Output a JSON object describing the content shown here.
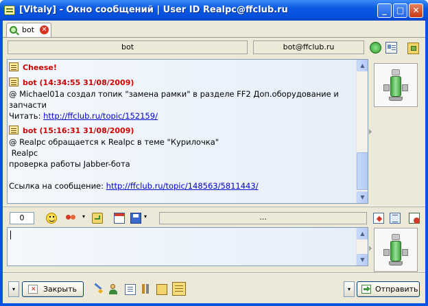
{
  "window": {
    "title": "[Vitaly] - Окно сообщений | User ID Realpc@ffclub.ru",
    "minimize_glyph": "_",
    "maximize_glyph": "□",
    "close_glyph": "✕"
  },
  "tabs": [
    {
      "label": "bot",
      "close_glyph": "✕"
    }
  ],
  "contact": {
    "name": "bot",
    "jid": "bot@ffclub.ru"
  },
  "messages": {
    "first_header": "Cheese!",
    "m1_header": "bot (14:34:55 31/08/2009)",
    "m1_line1": "@ Michael01a создал топик \"замена рамки\" в разделе FF2 Доп.оборудование и",
    "m1_line2": "запчасти",
    "m1_read_label": "Читать: ",
    "m1_link": "http://ffclub.ru/topic/152159/",
    "m2_header": "bot (15:16:31 31/08/2009)",
    "m2_line1": "@ Realpc обращается к Realpc в теме \"Курилочка\"",
    "m2_line2": " Realpc",
    "m2_line3": "проверка работы Jabber-бота",
    "m2_link_label": "Ссылка на сообщение: ",
    "m2_link": "http://ffclub.ru/topic/148563/5811443/"
  },
  "toolbar": {
    "char_count": "0",
    "status_text": "...",
    "dropdown_glyph": "▾"
  },
  "input": {
    "value": ""
  },
  "bottom": {
    "close_label": "Закрыть",
    "send_label": "Отправить",
    "dropdown_glyph": "▾"
  },
  "scroll": {
    "up_glyph": "▲",
    "down_glyph": "▼"
  },
  "colors": {
    "header_red": "#cc0000",
    "link_blue": "#0000cc",
    "xp_blue": "#0a53e0",
    "face": "#ece9d8"
  }
}
